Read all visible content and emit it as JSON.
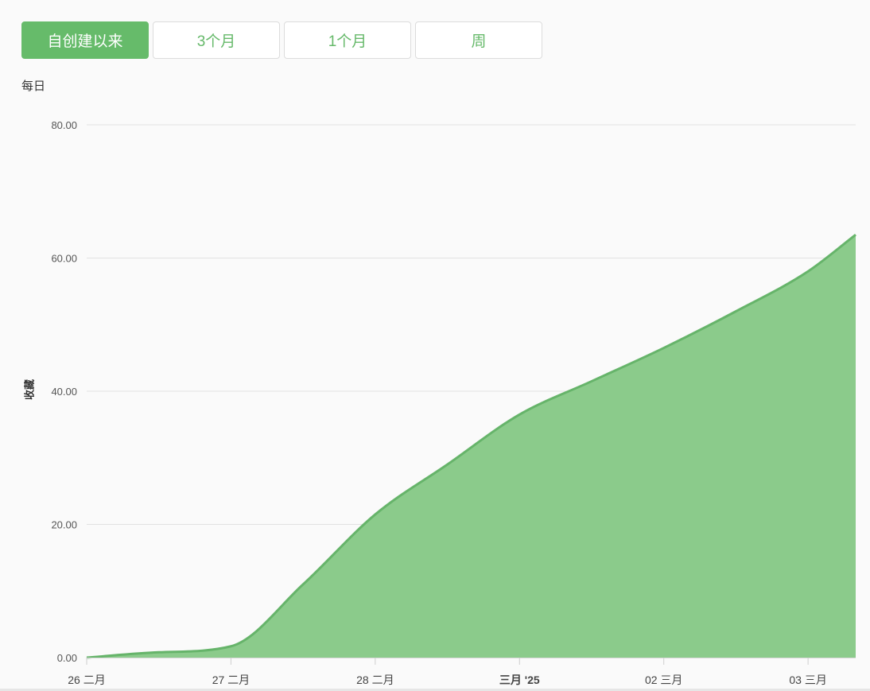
{
  "range_tabs": [
    {
      "label": "自创建以来",
      "active": true
    },
    {
      "label": "3个月",
      "active": false
    },
    {
      "label": "1个月",
      "active": false
    },
    {
      "label": "周",
      "active": false
    }
  ],
  "interval_label": "每日",
  "colors": {
    "accent": "#66bb6a",
    "area_fill": "#8bcb8b",
    "line": "#66b46a",
    "grid": "#e2e2e2"
  },
  "chart_data": {
    "type": "area",
    "ylabel": "收藏",
    "ylim": [
      0,
      80
    ],
    "yticks": [
      0,
      20,
      40,
      60,
      80
    ],
    "ytick_labels": [
      "0.00",
      "20.00",
      "40.00",
      "60.00",
      "80.00"
    ],
    "xlim": [
      0,
      5.33
    ],
    "xticks": [
      {
        "x": 0,
        "label": "26 二月",
        "bold": false
      },
      {
        "x": 1,
        "label": "27 二月",
        "bold": false
      },
      {
        "x": 2,
        "label": "28 二月",
        "bold": false
      },
      {
        "x": 3,
        "label": "三月 '25",
        "bold": true
      },
      {
        "x": 4,
        "label": "02 三月",
        "bold": false
      },
      {
        "x": 5,
        "label": "03 三月",
        "bold": false
      }
    ],
    "grid": true,
    "series": [
      {
        "points": [
          [
            0,
            0
          ],
          [
            0.5,
            0.8
          ],
          [
            1,
            1.7
          ],
          [
            1.5,
            11
          ],
          [
            2,
            21.5
          ],
          [
            2.5,
            29
          ],
          [
            3,
            36.5
          ],
          [
            3.5,
            41.5
          ],
          [
            4,
            46.5
          ],
          [
            4.5,
            52
          ],
          [
            5,
            58
          ],
          [
            5.33,
            63.5
          ]
        ]
      }
    ]
  }
}
